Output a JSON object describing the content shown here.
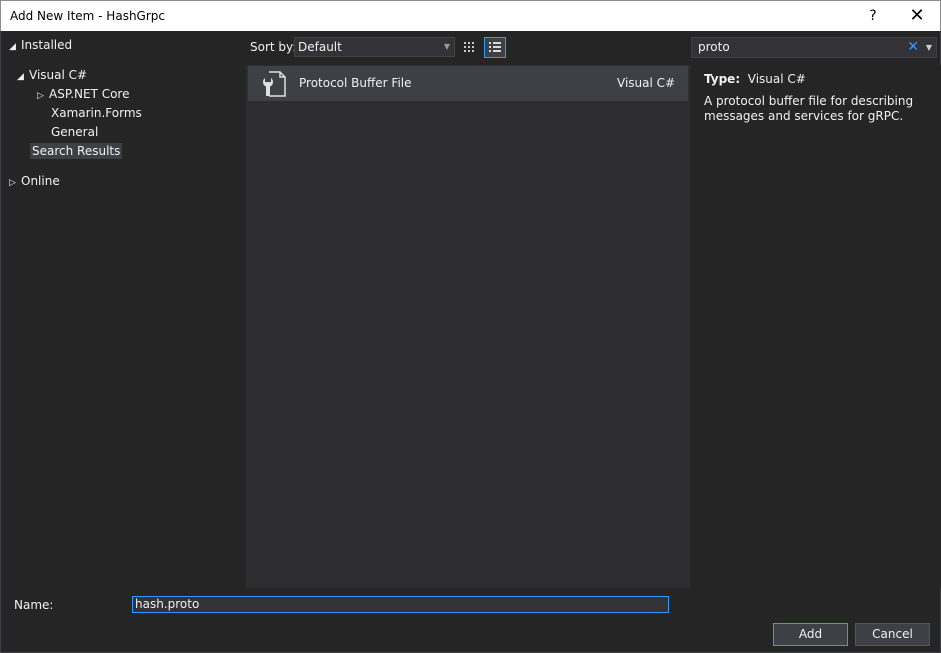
{
  "window": {
    "title": "Add New Item - HashGrpc",
    "help": "?",
    "close": "✕"
  },
  "tree": {
    "installed": "Installed",
    "visual_csharp": "Visual C#",
    "asp_net_core": "ASP.NET Core",
    "xamarin_forms": "Xamarin.Forms",
    "general": "General",
    "search_results": "Search Results",
    "online": "Online"
  },
  "toolbar": {
    "sort_label": "Sort by:",
    "sort_value": "Default"
  },
  "search": {
    "value": "proto",
    "clear_icon": "✕"
  },
  "results": [
    {
      "name": "Protocol Buffer File",
      "language": "Visual C#",
      "icon": "protobuf-file-icon"
    }
  ],
  "details": {
    "type_label": "Type:",
    "type_value": "Visual C#",
    "description": "A protocol buffer file for describing messages and services for gRPC."
  },
  "name_field": {
    "label": "Name:",
    "value": "hash.proto"
  },
  "buttons": {
    "add": "Add",
    "cancel": "Cancel"
  },
  "colors": {
    "accent": "#3399ff",
    "background": "#252526",
    "panel": "#2d2d30",
    "selected": "#3f3f46"
  }
}
